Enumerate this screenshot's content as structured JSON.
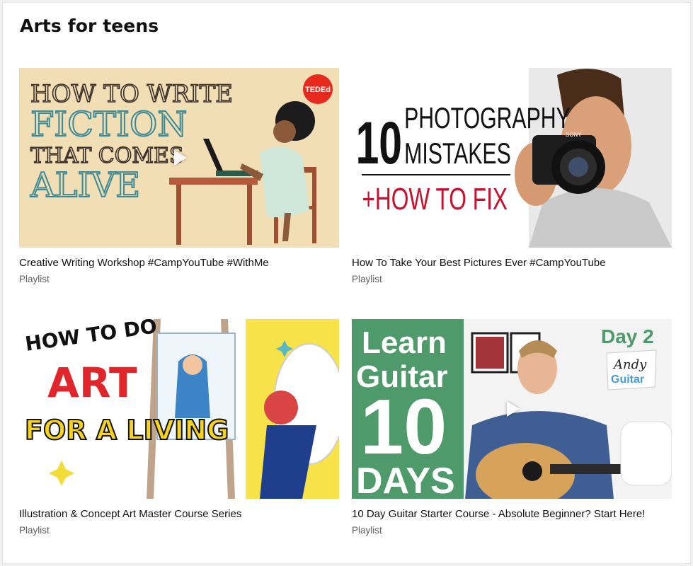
{
  "section": {
    "title": "Arts for teens"
  },
  "cards": [
    {
      "title": "Creative Writing Workshop #CampYouTube #WithMe",
      "subtitle": "Playlist",
      "thumb": {
        "line1": "HOW TO WRITE",
        "line2": "FICTION",
        "line3": "THAT COMES",
        "line4": "ALIVE",
        "badge": "TEDEd"
      }
    },
    {
      "title": "How To Take Your Best Pictures Ever #CampYouTube",
      "subtitle": "Playlist",
      "thumb": {
        "number": "10",
        "line1": "PHOTOGRAPHY",
        "line2": "MISTAKES",
        "line3": "+HOW TO FIX",
        "brand": "SONY"
      }
    },
    {
      "title": "Illustration & Concept Art Master Course Series",
      "subtitle": "Playlist",
      "thumb": {
        "line1": "HOW TO DO",
        "line2": "ART",
        "line3": "FOR A LIVING"
      }
    },
    {
      "title": "10 Day Guitar Starter Course - Absolute Beginner? Start Here!",
      "subtitle": "Playlist",
      "thumb": {
        "line1": "Learn",
        "line2": "Guitar",
        "line3": "10",
        "line4": "DAYS",
        "day": "Day 2",
        "logo1": "Andy",
        "logo2": "Guitar"
      }
    }
  ],
  "colors": {
    "ted_bg": "#f2deb4",
    "ted_red": "#e62b1e",
    "photo_red": "#c8102e",
    "art_yellow": "#f7e24a",
    "guitar_green": "#4f9a6a"
  },
  "icons": {
    "play": "play-icon"
  }
}
